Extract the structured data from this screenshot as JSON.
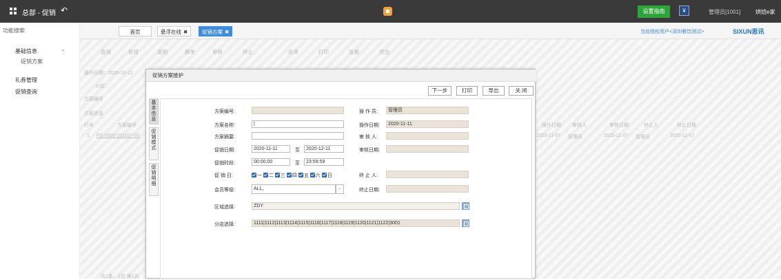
{
  "topbar": {
    "title": "总部 - 促销",
    "guide_button": "设置指南",
    "admin": "管理员[1001]",
    "org": "烘焙e家"
  },
  "sidebar": {
    "header": "功能搜索",
    "items": [
      {
        "label": "基础信息"
      },
      {
        "label": "促销方案"
      },
      {
        "label": "礼券管理"
      },
      {
        "label": "促销查询"
      }
    ]
  },
  "tabs": [
    {
      "label": "首页"
    },
    {
      "label": "悬浮在线"
    },
    {
      "label": "促销方案"
    }
  ],
  "tabbar": {
    "link": "当前授权用户<深圳餐饮测试>",
    "brand": "SIXUN思讯"
  },
  "background": {
    "toolbar": [
      "查询",
      "新增",
      "复制",
      "删单",
      "审核",
      "终止",
      "反审",
      "打印",
      "设置",
      "退出"
    ],
    "op_date": "操作日期：2020-10-12",
    "store": "分店：",
    "plan_no": "方案编号",
    "section": "方案信息",
    "columns": [
      "行号",
      "方案编号"
    ],
    "row_no": "1",
    "row_code": "PS-0000-201107-00",
    "right_columns": [
      "操作日期",
      "审核人",
      "审核日期",
      "终止人",
      "终止日期"
    ],
    "right_row": [
      "2020-11-07",
      "管理员",
      "2020-11-07",
      "管理员",
      "2020-11-07"
    ],
    "footer": "共1条，1页 第1页"
  },
  "modal": {
    "title": "促销方案维护",
    "buttons": {
      "next": "下一步",
      "print": "打印",
      "export": "导出",
      "close": "关 闭"
    },
    "vtabs": [
      "基本信息",
      "促销模式",
      "促销明细"
    ],
    "fields": {
      "plan_no_label": "方案编号:",
      "plan_name_label": "方案名称:",
      "plan_desc_label": "方案摘要:",
      "promo_date_label": "促销日期:",
      "promo_date_from": "2020-11-11",
      "to1": "至",
      "promo_date_to": "2020-12-11",
      "promo_time_label": "促销时段:",
      "promo_time_from": "00:00:00",
      "to2": "至",
      "promo_time_to": "23:59:59",
      "promo_day_label": "促 销 日:",
      "days": [
        "一",
        "二",
        "三",
        "四",
        "五",
        "六",
        "日"
      ],
      "member_label": "会员等级:",
      "member_value": "ALL,",
      "member_more": "...",
      "operator_label": "操 作 员:",
      "operator_value": "管理员",
      "op_date_label": "操作日期:",
      "op_date_value": "2020-11-11",
      "reviewer_label": "审 核 人:",
      "review_date_label": "审核日期:",
      "terminator_label": "终 止 人:",
      "term_date_label": "终止日期:",
      "area_label": "区域选择:",
      "area_value": "ZDY",
      "branch_label": "分店选择:",
      "branch_value": "1111|1112|1113|1114|1115|1116|1117|1118|1119|1120|1121|1122|3001"
    }
  }
}
